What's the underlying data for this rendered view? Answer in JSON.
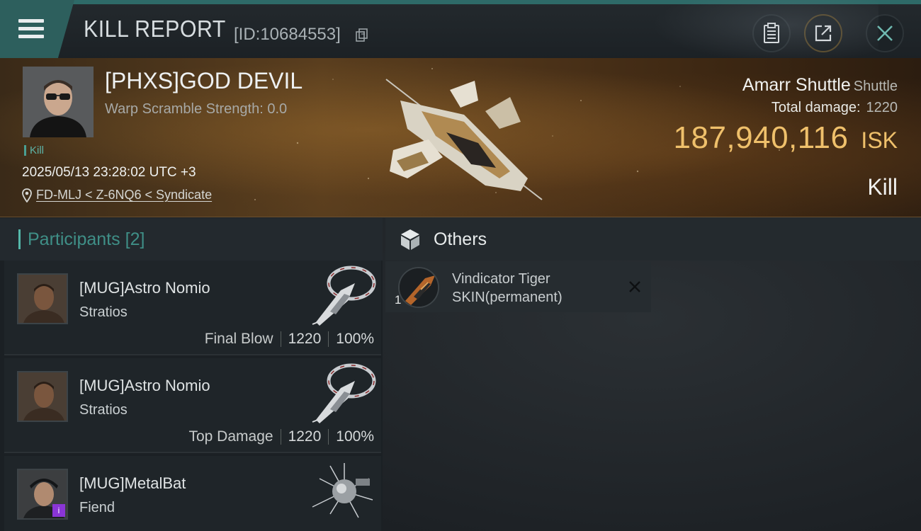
{
  "header": {
    "title": "KILL REPORT",
    "report_id": "[ID:10684553]"
  },
  "victim": {
    "name": "[PHXS]GOD DEVIL",
    "warp_scramble": "Warp Scramble Strength: 0.0",
    "status_tag": "Kill",
    "timestamp": "2025/05/13 23:28:02 UTC +3",
    "location": "FD-MLJ < Z-6NQ6 < Syndicate",
    "ship_name": "Amarr Shuttle",
    "ship_class": "Shuttle",
    "total_damage_label": "Total damage:",
    "total_damage": "1220",
    "isk_value": "187,940,116",
    "isk_unit": "ISK",
    "kill_type": "Kill"
  },
  "participants": {
    "label": "Participants",
    "count": "[2]",
    "rows": [
      {
        "name": "[MUG]Astro Nomio",
        "ship": "Stratios",
        "tag": "Final Blow",
        "damage": "1220",
        "percent": "100%"
      },
      {
        "name": "[MUG]Astro Nomio",
        "ship": "Stratios",
        "tag": "Top Damage",
        "damage": "1220",
        "percent": "100%"
      },
      {
        "name": "[MUG]MetalBat",
        "ship": "Fiend",
        "badge": "i"
      }
    ]
  },
  "others": {
    "label": "Others",
    "items": [
      {
        "qty": "1",
        "name": "Vindicator Tiger SKIN(permanent)"
      }
    ]
  },
  "colors": {
    "accent_teal": "#2d5f5d",
    "isk_gold": "#efc06b",
    "participants_label": "#3f8f87"
  }
}
